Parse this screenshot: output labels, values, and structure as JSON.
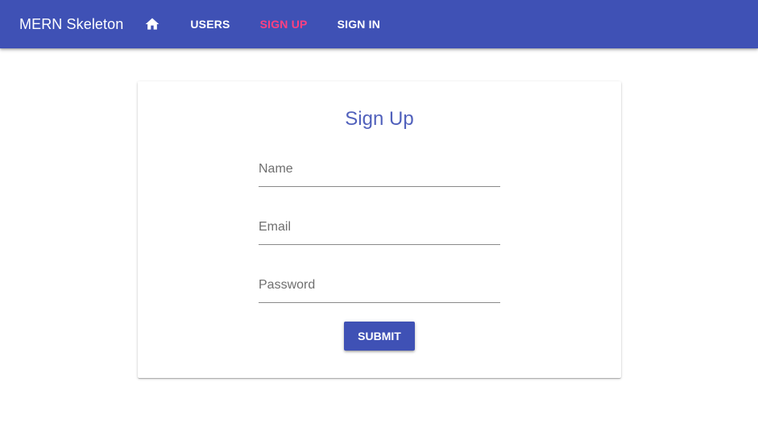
{
  "appbar": {
    "brand": "MERN Skeleton",
    "home_icon": "home-icon",
    "nav": [
      {
        "label": "USERS",
        "active": false
      },
      {
        "label": "SIGN UP",
        "active": true
      },
      {
        "label": "SIGN IN",
        "active": false
      }
    ],
    "background_color": "#3f51b5",
    "active_color": "#ff4081"
  },
  "signup": {
    "title": "Sign Up",
    "fields": {
      "name": {
        "label": "Name",
        "value": ""
      },
      "email": {
        "label": "Email",
        "value": ""
      },
      "password": {
        "label": "Password",
        "value": ""
      }
    },
    "submit_label": "SUBMIT"
  }
}
